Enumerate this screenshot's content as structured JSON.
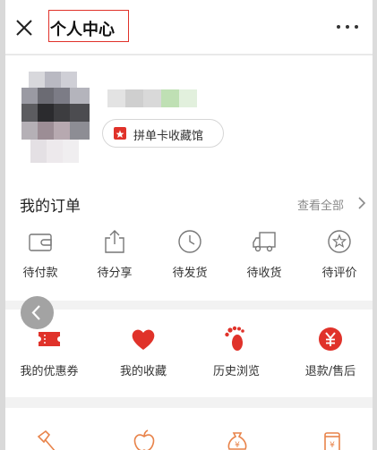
{
  "nav": {
    "title": "个人中心",
    "close_icon": "close-icon",
    "more_icon": "more-dots-icon"
  },
  "profile": {
    "collection_button_label": "拼单卡收藏馆",
    "collection_icon": "badge-icon"
  },
  "orders": {
    "title": "我的订单",
    "view_all_label": "查看全部",
    "items": [
      {
        "label": "待付款",
        "icon": "wallet-icon"
      },
      {
        "label": "待分享",
        "icon": "share-icon"
      },
      {
        "label": "待发货",
        "icon": "clock-icon"
      },
      {
        "label": "待收货",
        "icon": "truck-icon"
      },
      {
        "label": "待评价",
        "icon": "star-icon"
      }
    ]
  },
  "services": {
    "items": [
      {
        "label": "我的优惠券",
        "icon": "coupon-icon"
      },
      {
        "label": "我的收藏",
        "icon": "heart-icon"
      },
      {
        "label": "历史浏览",
        "icon": "footprint-icon"
      },
      {
        "label": "退款/售后",
        "icon": "refund-icon"
      }
    ]
  },
  "colors": {
    "accent": "#e0322a",
    "text_primary": "#222222",
    "text_secondary": "#8a8a8a",
    "background": "#f2f2f2",
    "floating_button": "#a3a3a3",
    "more_icons": "#e8834a"
  }
}
